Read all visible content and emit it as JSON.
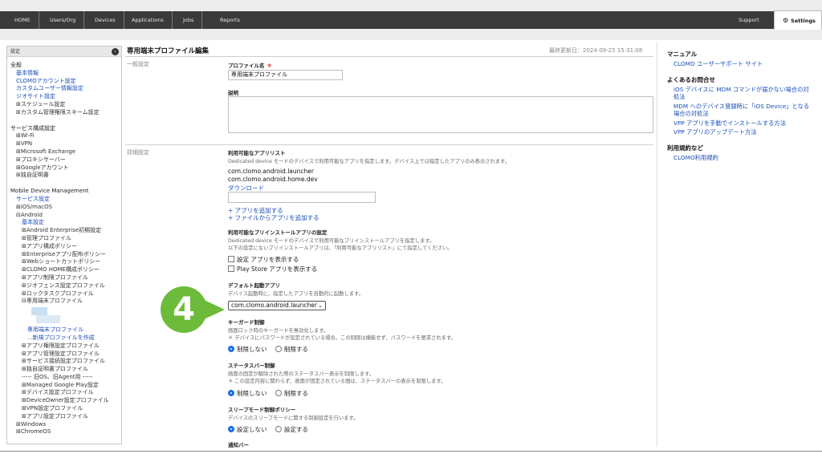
{
  "nav": {
    "items": [
      "HOME",
      "Users/Org",
      "Devices",
      "Applications",
      "Jobs",
      "Reports"
    ],
    "support": "Support",
    "settings": "Settings"
  },
  "sidebar": {
    "header": "設定",
    "rows": [
      {
        "t": "全般",
        "k": "sec",
        "i": 0
      },
      {
        "t": "基本情報",
        "k": "lnk",
        "i": 1
      },
      {
        "t": "CLOMOアカウント設定",
        "k": "lnk",
        "i": 1
      },
      {
        "t": "カスタムユーザー情報設定",
        "k": "lnk",
        "i": 1
      },
      {
        "t": "ジオサイト設定",
        "k": "lnk",
        "i": 1
      },
      {
        "t": "⊞スケジュール設定",
        "k": "txt",
        "i": 1
      },
      {
        "t": "⊞カスタム管理権限スキーム設定",
        "k": "txt",
        "i": 1
      },
      {
        "t": "",
        "k": "gap",
        "i": 0
      },
      {
        "t": "サービス構成設定",
        "k": "sec",
        "i": 0
      },
      {
        "t": "⊞Wi-Fi",
        "k": "txt",
        "i": 1
      },
      {
        "t": "⊞VPN",
        "k": "txt",
        "i": 1
      },
      {
        "t": "⊞Microsoft Exchange",
        "k": "txt",
        "i": 1
      },
      {
        "t": "⊞プロキシサーバー",
        "k": "txt",
        "i": 1
      },
      {
        "t": "⊞Googleアカウント",
        "k": "txt",
        "i": 1
      },
      {
        "t": "⊞独自証明書",
        "k": "txt",
        "i": 1
      },
      {
        "t": "",
        "k": "gap",
        "i": 0
      },
      {
        "t": "Mobile Device Management",
        "k": "sec",
        "i": 0
      },
      {
        "t": "サービス設定",
        "k": "lnk",
        "i": 1
      },
      {
        "t": "⊞iOS/macOS",
        "k": "txt",
        "i": 1
      },
      {
        "t": "⊟Android",
        "k": "txt",
        "i": 1
      },
      {
        "t": "基本設定",
        "k": "lnk",
        "i": 2
      },
      {
        "t": "⊞Android Enterprise初期設定",
        "k": "txt",
        "i": 2
      },
      {
        "t": "⊞管理プロファイル",
        "k": "txt",
        "i": 2
      },
      {
        "t": "⊞アプリ構成ポリシー",
        "k": "txt",
        "i": 2
      },
      {
        "t": "⊞Enterpriseアプリ配布ポリシー",
        "k": "txt",
        "i": 2
      },
      {
        "t": "⊞Webショートカットポリシー",
        "k": "txt",
        "i": 2
      },
      {
        "t": "⊞CLOMO HOME構成ポリシー",
        "k": "txt",
        "i": 2
      },
      {
        "t": "⊞アプリ制限プロファイル",
        "k": "txt",
        "i": 2
      },
      {
        "t": "⊞ジオフェンス設定プロファイル",
        "k": "txt",
        "i": 2
      },
      {
        "t": "⊞ロックタスクプロファイル",
        "k": "txt",
        "i": 2
      },
      {
        "t": "⊟専用端末プロファイル",
        "k": "txt",
        "i": 2
      },
      {
        "t": "",
        "k": "thumb",
        "i": 0
      },
      {
        "t": "専用端末プロファイル",
        "k": "lnk",
        "i": 3
      },
      {
        "t": "...新規プロファイルを作成",
        "k": "lnk",
        "i": 3
      },
      {
        "t": "⊞アプリ権限設定プロファイル",
        "k": "txt",
        "i": 2
      },
      {
        "t": "⊞アプリ管理設定プロファイル",
        "k": "txt",
        "i": 2
      },
      {
        "t": "⊞サービス接続設定プロファイル",
        "k": "txt",
        "i": 2
      },
      {
        "t": "⊞独自証明書プロファイル",
        "k": "txt",
        "i": 2
      },
      {
        "t": "----- 旧OS、旧Agent用 -----",
        "k": "txt",
        "i": 2
      },
      {
        "t": "⊞Managed Google Play設定",
        "k": "txt",
        "i": 2
      },
      {
        "t": "⊞デバイス設定プロファイル",
        "k": "txt",
        "i": 2
      },
      {
        "t": "⊞DeviceOwner設定プロファイル",
        "k": "txt",
        "i": 2
      },
      {
        "t": "⊞VPN設定プロファイル",
        "k": "txt",
        "i": 2
      },
      {
        "t": "⊞アプリ設定プロファイル",
        "k": "txt",
        "i": 2
      },
      {
        "t": "⊞Windows",
        "k": "txt",
        "i": 1
      },
      {
        "t": "⊞ChromeOS",
        "k": "txt",
        "i": 1
      }
    ]
  },
  "main": {
    "title": "専用端末プロファイル編集",
    "updated": "最終更新日：2024-09-25 15:31:08",
    "general": {
      "section": "一般設定",
      "name_label": "プロファイル名",
      "required_mark": "＊",
      "name_value": "専用端末プロファイル",
      "desc_label": "説明"
    },
    "detail": {
      "section": "詳細設定",
      "apps_label": "利用可能なアプリリスト",
      "apps_desc": "Dedicated device モードのデバイスで利用可能なアプリを指定します。デバイス上では指定したアプリのみ表示されます。",
      "app1": "com.clomo.android.launcher",
      "app2": "com.clomo.android.home.dev",
      "download": "ダウンロード",
      "add_app": "+ アプリを追加する",
      "add_file": "+ ファイルからアプリを追加する",
      "preinstall_label": "利用可能なプリインストールアプリの設定",
      "preinstall_desc1": "Dedicated device モードのデバイスで利用可能なプリインストールアプリを指定します。",
      "preinstall_desc2": "以下の設定にないプリインストールアプリは、「利用可能なアプリリスト」にて指定してください。",
      "chk_settings": "設定 アプリを表示する",
      "chk_playstore": "Play Store アプリを表示する",
      "default_label": "デフォルト起動アプリ",
      "default_desc": "デバイス起動時に、指定したアプリを自動的に起動します。",
      "default_value": "com.clomo.android.launcher",
      "keyguard_label": "キーガード制御",
      "keyguard_desc1": "画面ロック時のキーガードを無効化します。",
      "keyguard_desc2": "＊ デバイスにパスワードが設定されている場合、この制限は機能せず、パスワードを要求されます。",
      "status_label": "ステータスバー制御",
      "status_desc1": "画面の固定が解除された際のステータスバー表示を制限します。",
      "status_desc2": "＊ この設定内容に関わらず、画面が固定されている間は、ステータスバーの表示を制限します。",
      "sleep_label": "スリープモード制御ポリシー",
      "sleep_desc": "デバイスのスリープモードに関する制御設定を行います。",
      "notify_label": "通知バー",
      "opt_no_restrict": "制限しない",
      "opt_restrict": "制限する",
      "opt_no_set": "設定しない",
      "opt_set": "設定する"
    },
    "callout": "4"
  },
  "right": {
    "manual_head": "マニュアル",
    "manual_link": "CLOMO ユーザーサポート サイト",
    "faq_head": "よくあるお問合せ",
    "faq1a": "iOS デバイスに MDM コマンドが届かない場合の対",
    "faq1b": "処法",
    "faq2a": "MDM へのデバイス登録時に「iOS Device」となる",
    "faq2b": "場合の対処法",
    "faq3": "VPP アプリを手動でインストールする方法",
    "faq4": "VPP アプリのアップデート方法",
    "terms_head": "利用規約など",
    "terms_link": "CLOMO利用規約"
  }
}
